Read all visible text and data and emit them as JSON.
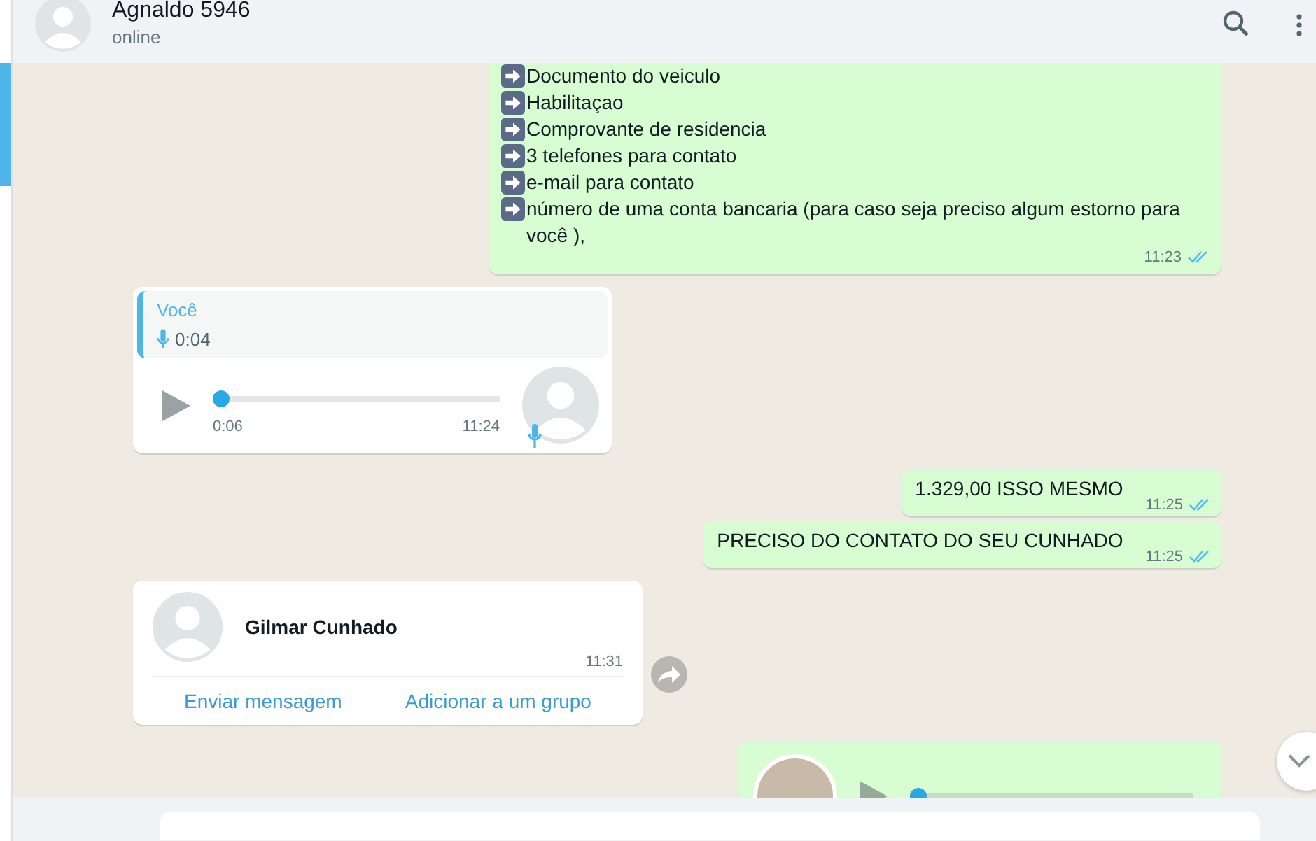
{
  "header": {
    "name": "Agnaldo 5946",
    "status": "online"
  },
  "messages": [
    {
      "kind": "list",
      "outgoing": true,
      "items": [
        "Documento do veiculo",
        "Habilitaçao",
        "Comprovante de residencia",
        "3 telefones para contato",
        "e-mail para contato",
        "número de uma conta bancaria (para caso seja preciso algum estorno para você ),"
      ],
      "time": "11:23"
    },
    {
      "kind": "voice",
      "outgoing": false,
      "quote": {
        "author": "Você",
        "duration": "0:04"
      },
      "level": 0,
      "duration": "0:06",
      "time": "11:24"
    },
    {
      "kind": "text",
      "outgoing": true,
      "text": "1.329,00 ISSO MESMO",
      "time": "11:25"
    },
    {
      "kind": "text",
      "outgoing": true,
      "text": "PRECISO DO CONTATO DO SEU CUNHADO",
      "time": "11:25"
    },
    {
      "kind": "contact",
      "outgoing": false,
      "name": "Gilmar Cunhado",
      "time": "11:31",
      "actions": [
        "Enviar mensagem",
        "Adicionar a um grupo"
      ]
    },
    {
      "kind": "voice",
      "outgoing": true,
      "level": 0
    }
  ]
}
